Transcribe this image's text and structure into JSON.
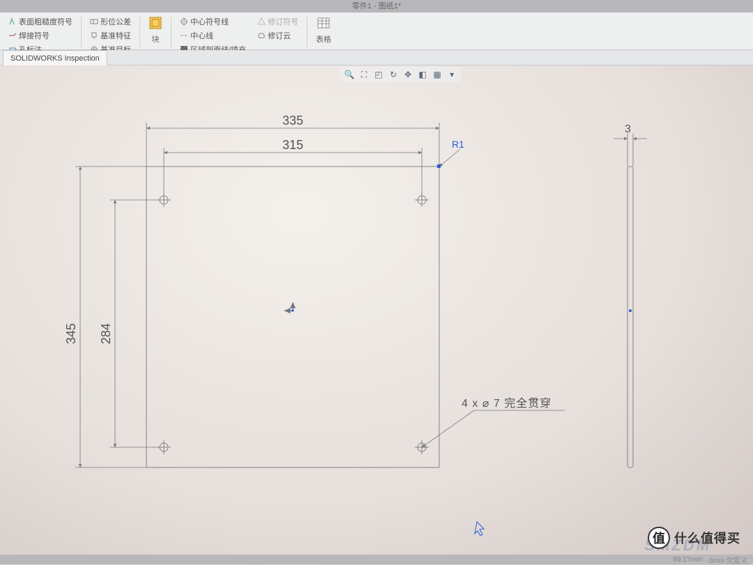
{
  "window": {
    "title": "零件1 - 图纸1*"
  },
  "ribbon": {
    "grp1": {
      "surface_finish": "表面粗糙度符号",
      "weld_symbol": "焊接符号",
      "hole_callout": "孔标注"
    },
    "grp2": {
      "geom_tol": "形位公差",
      "datum_feature": "基准特征",
      "datum_target": "基准目标"
    },
    "grp3": {
      "block_label": "块"
    },
    "grp4": {
      "center_mark": "中心符号线",
      "centerline": "中心线",
      "area_hatch": "区域剖面线/填充",
      "rev_symbol": "修订符号",
      "rev_cloud": "修订云"
    },
    "grp5": {
      "tables": "表格"
    }
  },
  "tabs": {
    "inspection": "SOLIDWORKS Inspection"
  },
  "view_toolbar": {
    "icons": [
      "zoom-icon",
      "zoom-fit-icon",
      "zoom-window-icon",
      "rotate-icon",
      "pan-icon",
      "section-icon",
      "display-icon",
      "perspective-icon",
      "more-icon"
    ]
  },
  "drawing": {
    "dims": {
      "width_outer": "335",
      "width_inner": "315",
      "height_outer": "345",
      "height_inner": "284",
      "thickness": "3",
      "radius": "R1"
    },
    "hole_note": "4 x ⌀ 7 完全贯穿"
  },
  "status": {
    "mm": "89.17mm",
    "def": "0mm 欠定义"
  },
  "watermark": {
    "zhi": "值",
    "text": "什么值得买",
    "smzdm": "SMZDM"
  }
}
